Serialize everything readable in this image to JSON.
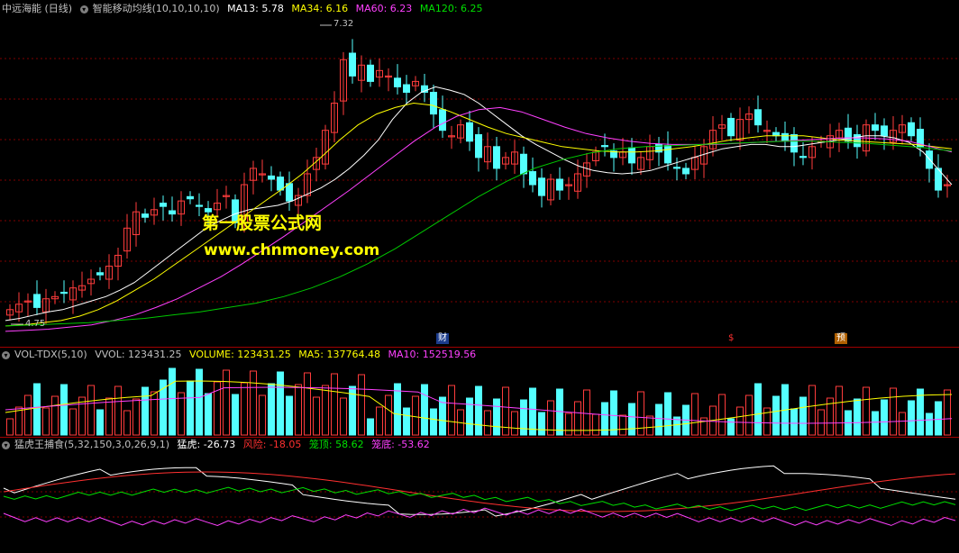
{
  "colors": {
    "up": "#ff3c3c",
    "down": "#54ffff",
    "ma13": "#ffffff",
    "ma34": "#ffff00",
    "ma60": "#ff40ff",
    "ma120": "#00c800",
    "grid": "#800000",
    "wm": "#ffff00"
  },
  "main": {
    "title": "中远海能 (日线)",
    "indicator": "智能移动均线(10,10,10,10)",
    "ma13": "MA13: 5.78",
    "ma34": "MA34: 6.16",
    "ma60": "MA60: 6.23",
    "ma120": "MA120: 6.25",
    "high_label": "7.32",
    "low_label": "4.75",
    "markers": {
      "cai": "财",
      "s": "$",
      "yu": "预"
    }
  },
  "watermark": {
    "line1": "第一股票公式网",
    "line2": "www.chnmoney.com"
  },
  "vol": {
    "title": "VOL-TDX(5,10)",
    "vvol": "VVOL: 123431.25",
    "volume": "VOLUME: 123431.25",
    "ma5": "MA5: 137764.48",
    "ma10": "MA10: 152519.56"
  },
  "tiger": {
    "title": "猛虎王捕食(5,32,150,3,0,26,9,1)",
    "tiger": "猛虎: -26.73",
    "risk": "风险: -18.05",
    "top": "笼顶: 58.62",
    "bottom": "笼底: -53.62"
  },
  "icons": {
    "main": "gear-icon",
    "vol": "gear-icon",
    "tiger": "gear-icon"
  },
  "chart_data": {
    "type": "candlestick",
    "ylim": [
      4.5,
      7.5
    ],
    "labels_shown": {
      "max": 7.32,
      "min": 4.75
    },
    "close": [
      4.8,
      4.85,
      4.88,
      4.82,
      4.9,
      4.92,
      4.95,
      5.0,
      5.02,
      5.08,
      5.12,
      5.2,
      5.3,
      5.55,
      5.7,
      5.65,
      5.72,
      5.75,
      5.68,
      5.8,
      5.82,
      5.75,
      5.7,
      5.78,
      5.85,
      5.6,
      5.95,
      6.1,
      6.05,
      6.0,
      5.9,
      5.8,
      5.85,
      6.05,
      6.2,
      6.45,
      6.7,
      7.1,
      6.95,
      7.05,
      6.9,
      7.0,
      6.95,
      6.85,
      6.8,
      6.9,
      6.8,
      6.6,
      6.45,
      6.4,
      6.5,
      6.35,
      6.2,
      6.3,
      6.1,
      6.2,
      6.25,
      6.05,
      5.95,
      5.85,
      6.0,
      5.9,
      5.95,
      6.05,
      6.15,
      6.25,
      6.3,
      6.2,
      6.25,
      6.15,
      6.2,
      6.3,
      6.25,
      6.15,
      6.1,
      6.05,
      6.2,
      6.3,
      6.45,
      6.5,
      6.4,
      6.55,
      6.6,
      6.5,
      6.45,
      6.4,
      6.35,
      6.25,
      6.2,
      6.3,
      6.35,
      6.4,
      6.45,
      6.35,
      6.3,
      6.5,
      6.45,
      6.4,
      6.45,
      6.5,
      6.4,
      6.3,
      6.1,
      5.9,
      5.95
    ],
    "ma13": [
      4.7,
      4.72,
      4.75,
      4.78,
      4.8,
      4.84,
      4.88,
      4.92,
      4.98,
      5.05,
      5.15,
      5.25,
      5.35,
      5.45,
      5.55,
      5.62,
      5.68,
      5.72,
      5.74,
      5.76,
      5.8,
      5.86,
      5.92,
      6.0,
      6.1,
      6.22,
      6.36,
      6.55,
      6.7,
      6.8,
      6.85,
      6.82,
      6.78,
      6.7,
      6.6,
      6.5,
      6.4,
      6.32,
      6.25,
      6.18,
      6.12,
      6.08,
      6.06,
      6.05,
      6.06,
      6.08,
      6.12,
      6.16,
      6.2,
      6.24,
      6.28,
      6.3,
      6.32,
      6.32,
      6.3,
      6.3,
      6.32,
      6.34,
      6.36,
      6.38,
      6.4,
      6.4,
      6.38,
      6.34,
      6.25,
      6.1,
      5.95
    ],
    "ma34": [
      4.65,
      4.66,
      4.68,
      4.7,
      4.74,
      4.8,
      4.88,
      4.98,
      5.08,
      5.2,
      5.32,
      5.44,
      5.56,
      5.68,
      5.8,
      5.92,
      6.05,
      6.2,
      6.36,
      6.5,
      6.6,
      6.66,
      6.7,
      6.68,
      6.62,
      6.55,
      6.48,
      6.42,
      6.38,
      6.34,
      6.3,
      6.28,
      6.26,
      6.25,
      6.25,
      6.26,
      6.28,
      6.3,
      6.33,
      6.36,
      6.38,
      6.4,
      6.4,
      6.4,
      6.38,
      6.36,
      6.35,
      6.34,
      6.33,
      6.32,
      6.3,
      6.28
    ],
    "ma60": [
      4.6,
      4.61,
      4.62,
      4.64,
      4.66,
      4.7,
      4.75,
      4.82,
      4.9,
      5.0,
      5.1,
      5.22,
      5.35,
      5.48,
      5.62,
      5.76,
      5.9,
      6.05,
      6.2,
      6.35,
      6.48,
      6.58,
      6.64,
      6.66,
      6.62,
      6.55,
      6.48,
      6.42,
      6.38,
      6.35,
      6.33,
      6.32,
      6.32,
      6.32,
      6.33,
      6.34,
      6.35,
      6.36,
      6.37,
      6.38,
      6.38,
      6.37,
      6.35,
      6.3,
      6.25
    ],
    "ma120": [
      4.65,
      4.66,
      4.67,
      4.68,
      4.7,
      4.72,
      4.75,
      4.78,
      4.82,
      4.86,
      4.92,
      5.0,
      5.1,
      5.22,
      5.36,
      5.52,
      5.68,
      5.84,
      5.98,
      6.1,
      6.18,
      6.24,
      6.28,
      6.3,
      6.31,
      6.32,
      6.33,
      6.34,
      6.35,
      6.35,
      6.34,
      6.33,
      6.31,
      6.29,
      6.26
    ]
  }
}
